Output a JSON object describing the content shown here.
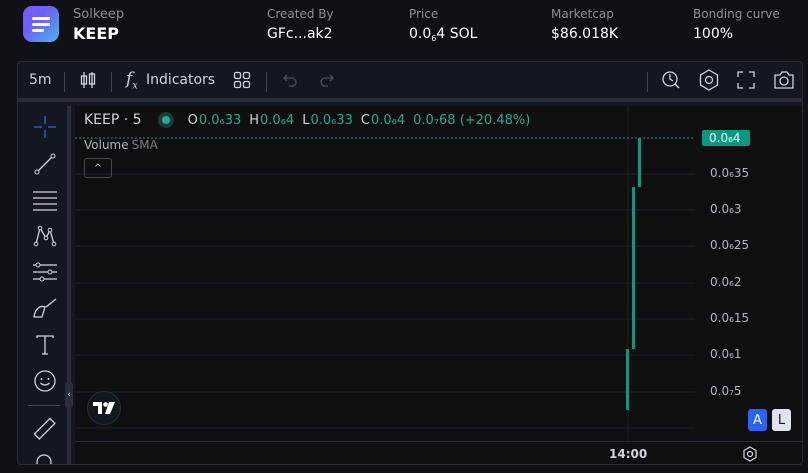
{
  "header": {
    "brand_name": "Solkeep",
    "brand_ticker": "KEEP",
    "stats": [
      {
        "label": "Created By",
        "value": "GFc...ak2"
      },
      {
        "label": "Price",
        "value_pre": "0.0",
        "value_sub": "6",
        "value_post": "4 SOL"
      },
      {
        "label": "Marketcap",
        "value": "$86.018K"
      },
      {
        "label": "Bonding curve",
        "value": "100%"
      }
    ]
  },
  "toolbar": {
    "interval": "5m",
    "indicators_label": "Indicators"
  },
  "legend": {
    "symbol": "KEEP · 5",
    "o_key": "O",
    "o_val": "0.0₆33",
    "h_key": "H",
    "h_val": "0.0₆4",
    "l_key": "L",
    "l_val": "0.0₆33",
    "c_key": "C",
    "c_val": "0.0₆4",
    "change": "0.0₇68 (+20.48%)",
    "volume_label": "Volume",
    "volume_ind": "SMA"
  },
  "price_scale": {
    "current": "0.0₆4",
    "labels": [
      "0.0₆35",
      "0.0₆3",
      "0.0₆25",
      "0.0₆2",
      "0.0₆15",
      "0.0₆1",
      "0.0₇5"
    ]
  },
  "time_scale": {
    "label": "14:00"
  },
  "scale_buttons": {
    "auto": "A",
    "log": "L"
  },
  "colors": {
    "up": "#089981",
    "accent": "#2962ff",
    "bg": "#0f0f0f"
  }
}
